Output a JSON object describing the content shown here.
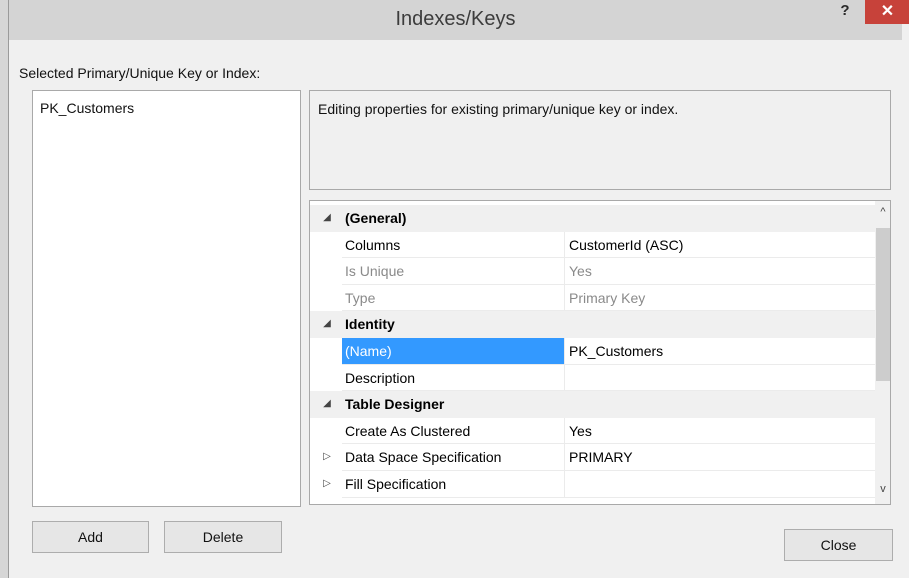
{
  "window": {
    "title": "Indexes/Keys",
    "help": "?",
    "close": "✕"
  },
  "keys": {
    "label": "Selected Primary/Unique Key or Index:",
    "items": [
      "PK_Customers"
    ]
  },
  "buttons": {
    "add": "Add",
    "delete": "Delete",
    "close": "Close"
  },
  "description": "Editing properties for existing primary/unique key or index.",
  "properties": {
    "general": {
      "label": "(General)",
      "columns": {
        "name": "Columns",
        "value": "CustomerId (ASC)"
      },
      "is_unique": {
        "name": "Is Unique",
        "value": "Yes"
      },
      "type": {
        "name": "Type",
        "value": "Primary Key"
      }
    },
    "identity": {
      "label": "Identity",
      "name": {
        "name": "(Name)",
        "value": "PK_Customers"
      },
      "description": {
        "name": "Description",
        "value": ""
      }
    },
    "table_designer": {
      "label": "Table Designer",
      "create_as_clustered": {
        "name": "Create As Clustered",
        "value": "Yes"
      },
      "data_space": {
        "name": "Data Space Specification",
        "value": "PRIMARY"
      },
      "fill_spec": {
        "name": "Fill Specification",
        "value": ""
      }
    }
  },
  "glyphs": {
    "expanded": "◢",
    "collapsed": "▷",
    "scroll_up": "^",
    "scroll_down": "v"
  },
  "colors": {
    "selection": "#3399ff",
    "close_button": "#c7423a"
  }
}
